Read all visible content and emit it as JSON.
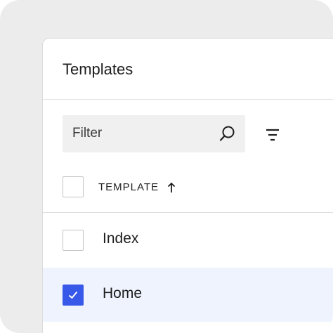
{
  "panel": {
    "title": "Templates"
  },
  "search": {
    "placeholder": "Filter",
    "icon": "search-icon"
  },
  "filter": {
    "icon": "filter-icon"
  },
  "table": {
    "column_header": "TEMPLATE",
    "sort": {
      "direction": "ascending",
      "icon": "arrow-up-icon"
    },
    "select_all_checked": false,
    "rows": [
      {
        "label": "Index",
        "checked": false
      },
      {
        "label": "Home",
        "checked": true
      }
    ]
  },
  "colors": {
    "accent": "#3858e9",
    "selected_row": "#eff3fd"
  }
}
